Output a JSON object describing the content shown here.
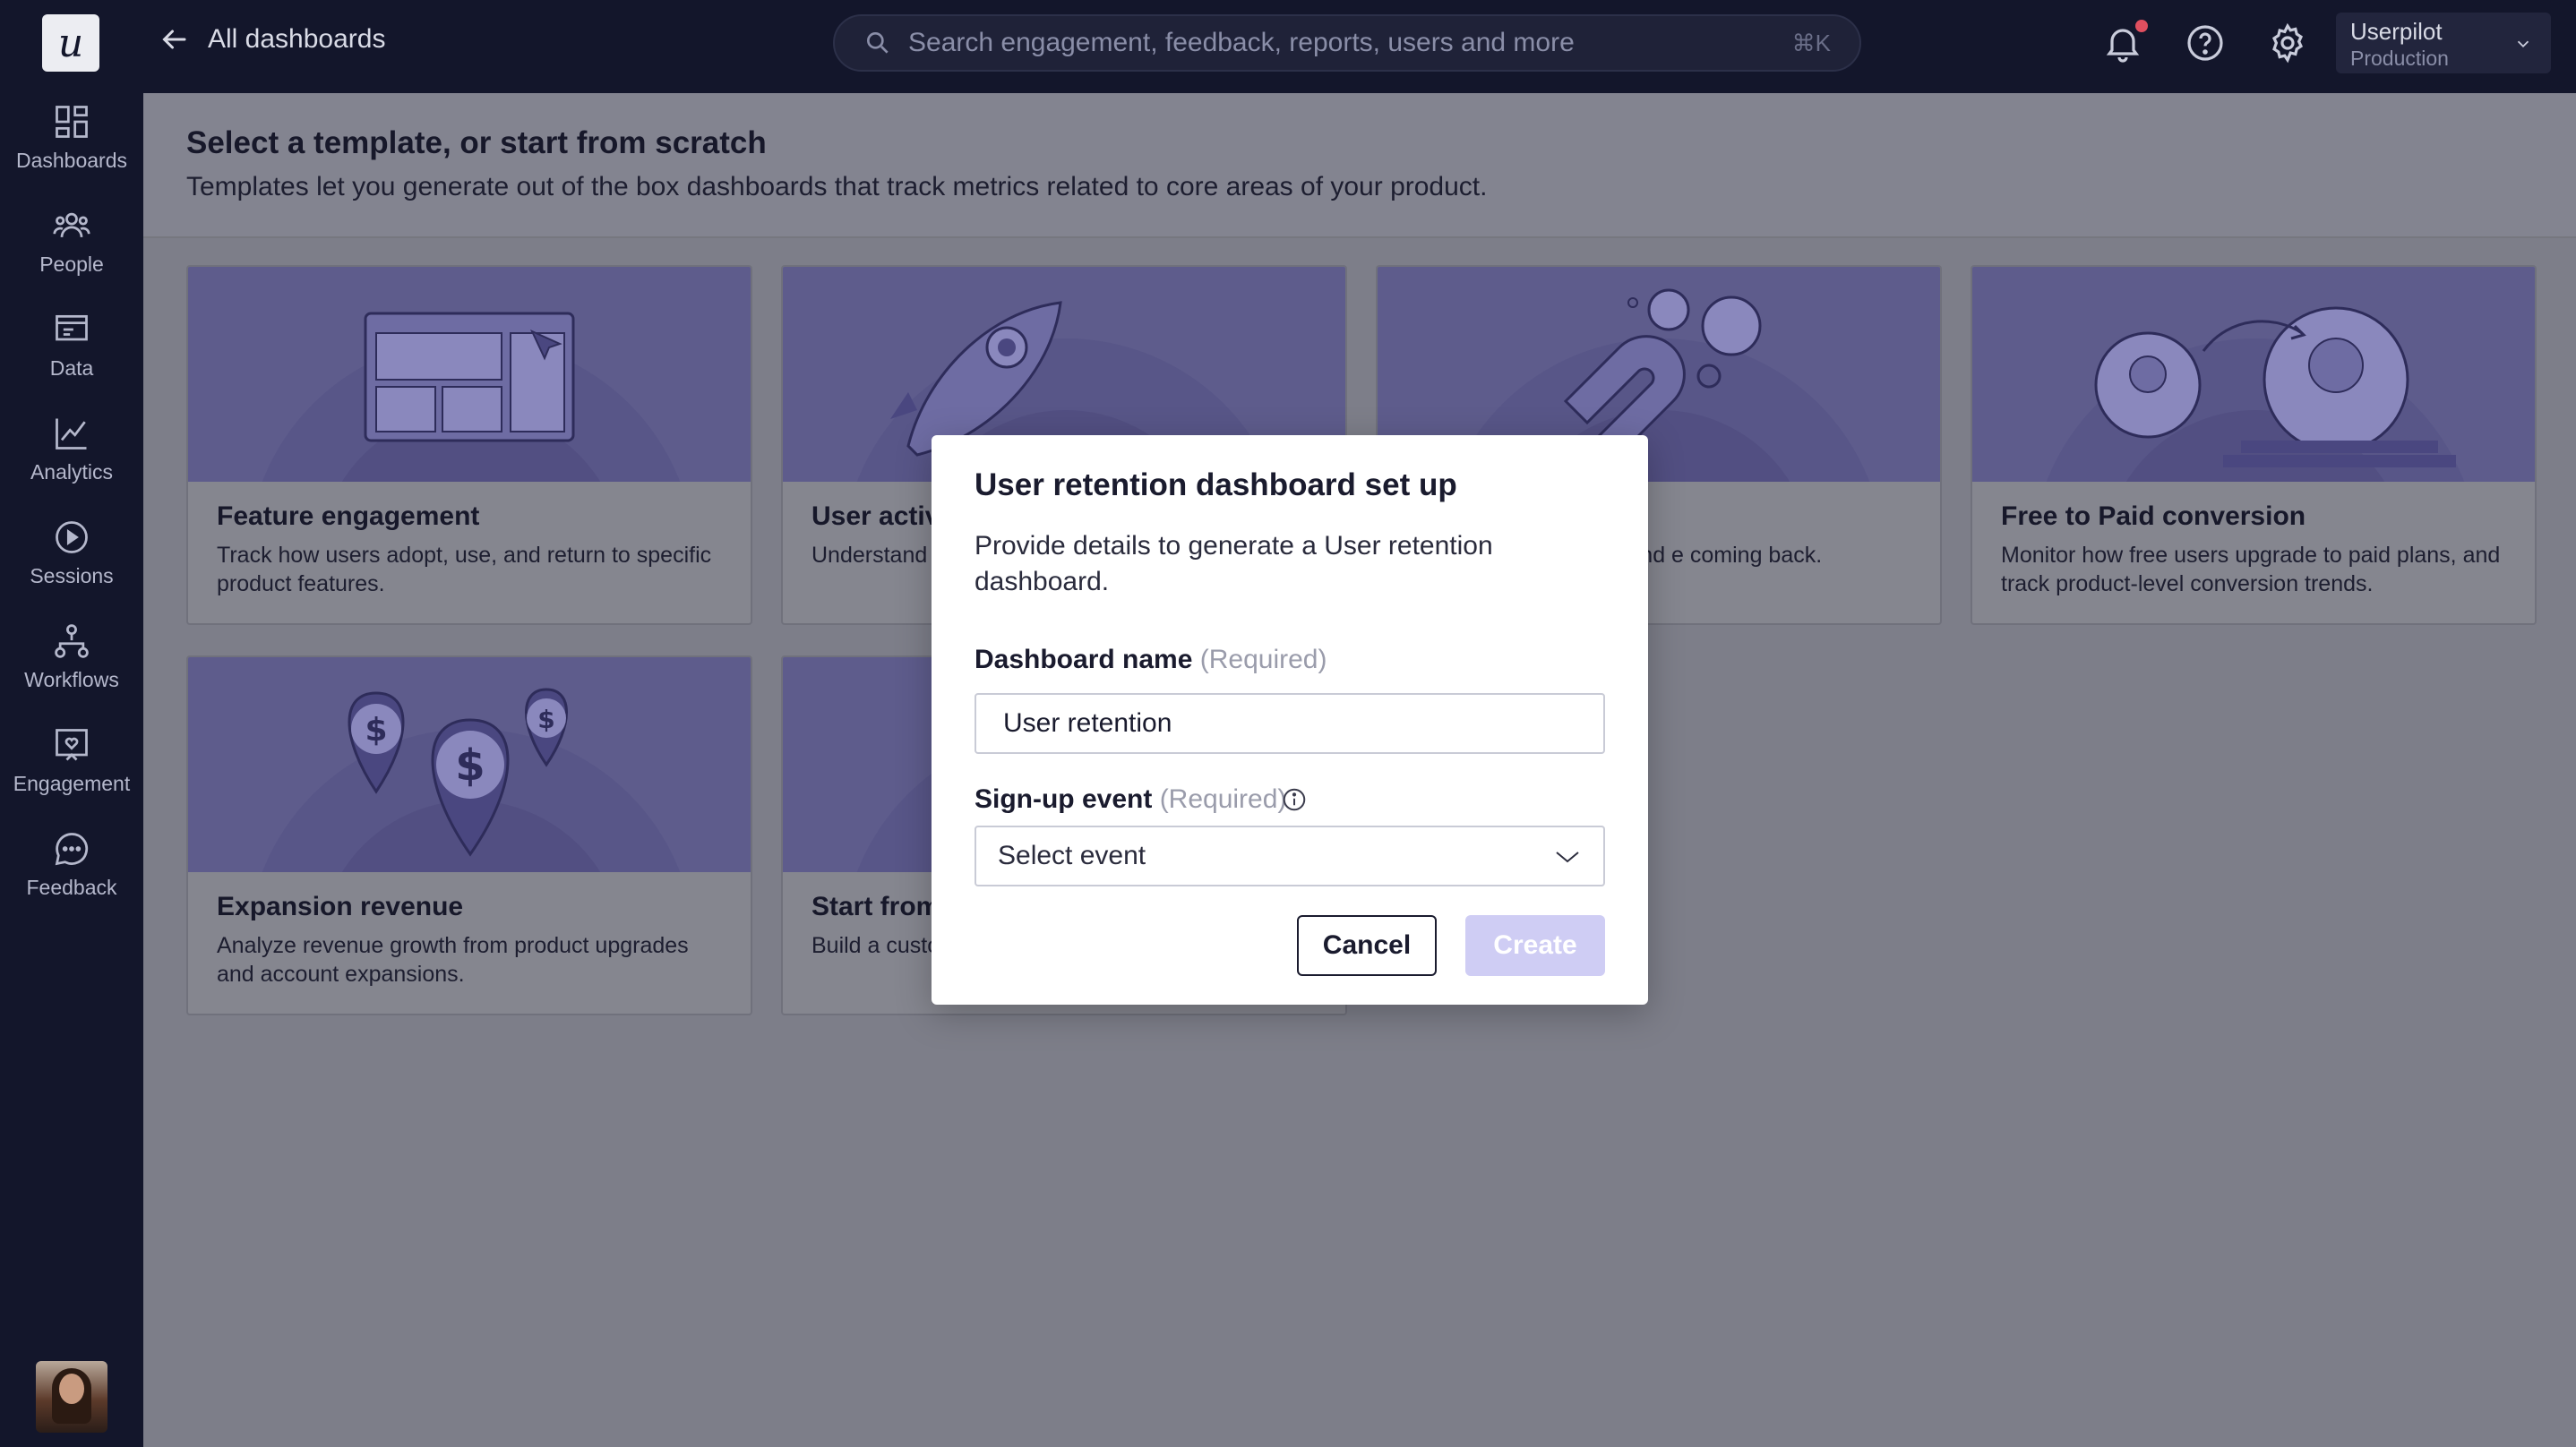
{
  "app": {
    "logo_letter": "u",
    "back_label": "All dashboards"
  },
  "search": {
    "placeholder": "Search engagement, feedback, reports, users and more",
    "shortcut": "⌘K"
  },
  "account": {
    "name": "Userpilot",
    "environment": "Production"
  },
  "sidebar": {
    "items": [
      {
        "label": "Dashboards",
        "icon": "dashboard-icon"
      },
      {
        "label": "People",
        "icon": "people-icon"
      },
      {
        "label": "Data",
        "icon": "data-icon"
      },
      {
        "label": "Analytics",
        "icon": "analytics-icon"
      },
      {
        "label": "Sessions",
        "icon": "sessions-icon"
      },
      {
        "label": "Workflows",
        "icon": "workflows-icon"
      },
      {
        "label": "Engagement",
        "icon": "engagement-icon"
      },
      {
        "label": "Feedback",
        "icon": "feedback-icon"
      }
    ]
  },
  "page": {
    "title": "Select a template, or start from scratch",
    "subtitle": "Templates let you generate out of the box dashboards that track metrics related to core areas of your product."
  },
  "cards": [
    {
      "title": "Feature engagement",
      "description": "Track how users adopt, use, and return to specific product features."
    },
    {
      "title": "User activ",
      "description": "Understand product eng"
    },
    {
      "title": "",
      "description": "duct usage, retention, and e coming back."
    },
    {
      "title": "Free to Paid conversion",
      "description": "Monitor how free users upgrade to paid plans, and track product-level conversion trends."
    },
    {
      "title": "Expansion revenue",
      "description": "Analyze revenue growth from product upgrades and account expansions."
    },
    {
      "title": "Start from",
      "description": "Build a custo tailored to y"
    }
  ],
  "modal": {
    "title": "User retention dashboard set up",
    "description": "Provide details to generate a User retention dashboard.",
    "name_label": "Dashboard name",
    "name_required": "(Required)",
    "name_value": "User retention",
    "event_label": "Sign-up event",
    "event_required": "(Required)",
    "event_value": "Select event",
    "cancel_label": "Cancel",
    "create_label": "Create"
  },
  "colors": {
    "accent_disabled": "#cfcdf4",
    "notification_dot": "#e04f5f",
    "sidebar_bg": "#13162b"
  }
}
